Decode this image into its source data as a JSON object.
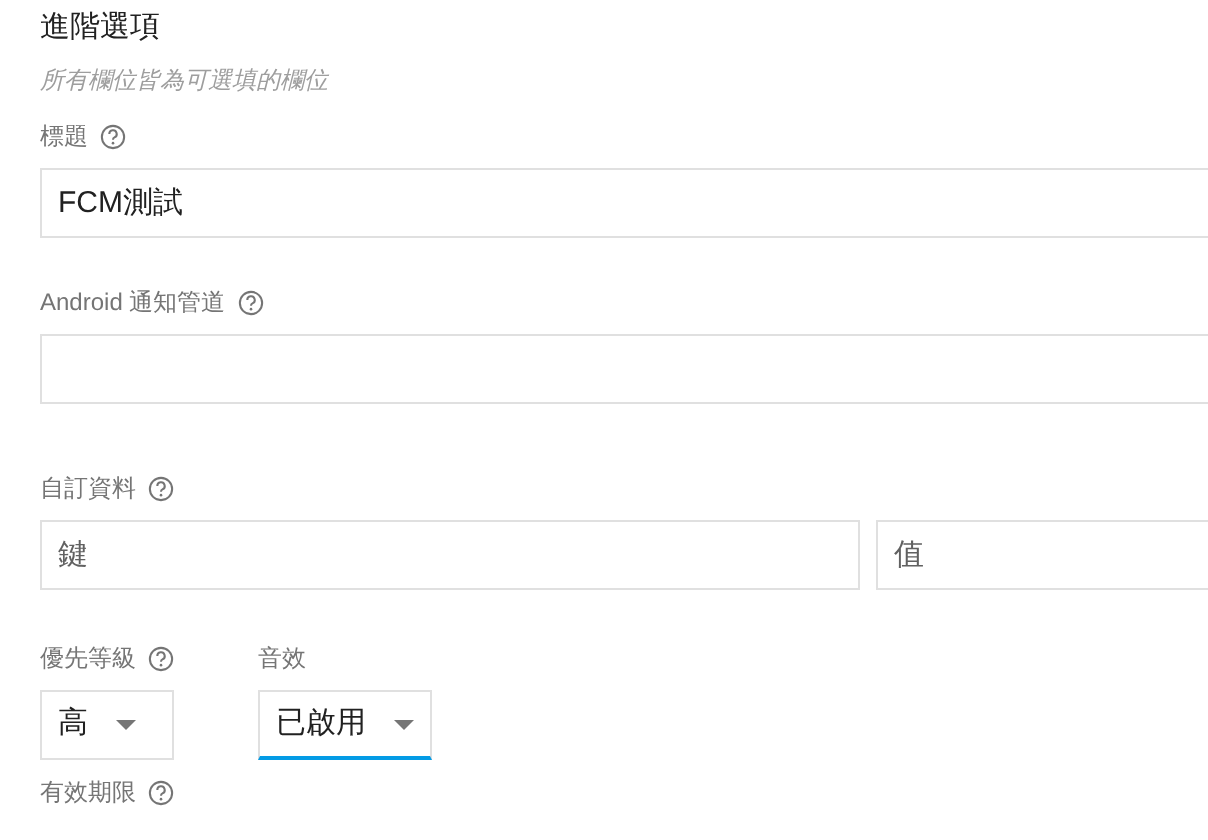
{
  "section": {
    "title": "進階選項",
    "subtitle": "所有欄位皆為可選填的欄位"
  },
  "fields": [
    {
      "kind": "text",
      "label": "標題",
      "help": true,
      "value": "FCM測試"
    },
    {
      "kind": "text",
      "label": "Android 通知管道",
      "help": true
    },
    {
      "kind": "pair",
      "label": "自訂資料",
      "help": true,
      "inputs": [
        {
          "placeholder": "鍵"
        },
        {
          "placeholder": "值"
        }
      ]
    }
  ],
  "selects": [
    {
      "label": "優先等級",
      "help": true,
      "value": "高",
      "focused": false
    },
    {
      "label": "音效",
      "help": false,
      "value": "已啟用",
      "focused": true
    }
  ],
  "next_field": {
    "label": "有效期限",
    "help": true
  }
}
